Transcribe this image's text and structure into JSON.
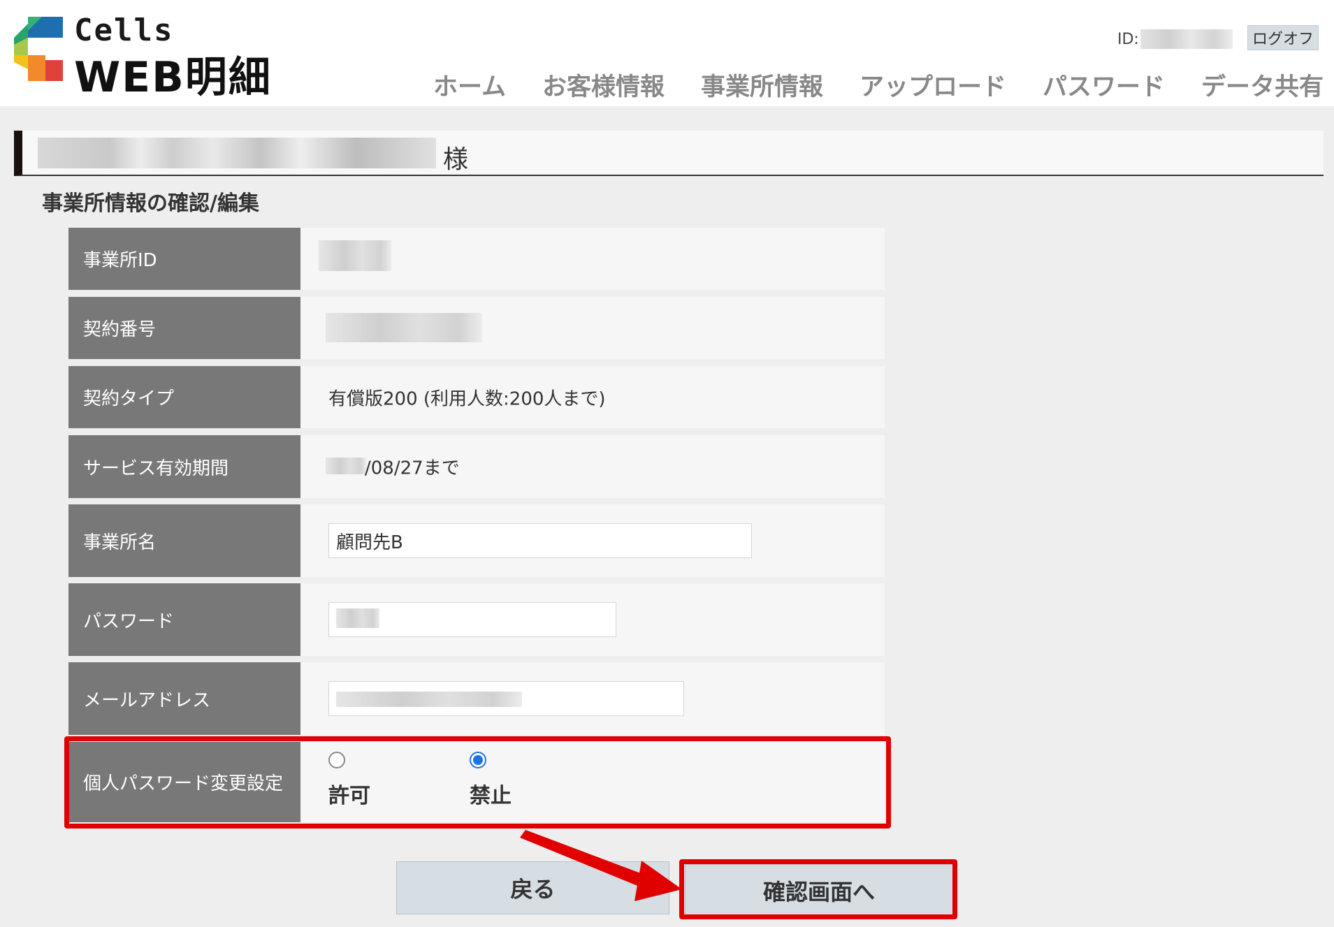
{
  "header": {
    "logo_small": "Cells",
    "logo_big": "WEB明細",
    "id_label": "ID:",
    "logoff_label": "ログオフ",
    "nav": [
      "ホーム",
      "お客様情報",
      "事業所情報",
      "アップロード",
      "パスワード",
      "データ共有"
    ]
  },
  "customer": {
    "suffix": "様"
  },
  "section_title": "事業所情報の確認/編集",
  "form": {
    "office_id_label": "事業所ID",
    "contract_no_label": "契約番号",
    "contract_type_label": "契約タイプ",
    "contract_type_value": "有償版200 (利用人数:200人まで)",
    "service_period_label": "サービス有効期間",
    "service_period_value": "/08/27まで",
    "office_name_label": "事業所名",
    "office_name_value": "顧問先B",
    "password_label": "パスワード",
    "email_label": "メールアドレス",
    "pw_change_label": "個人パスワード変更設定",
    "pw_change_options": [
      "許可",
      "禁止"
    ],
    "pw_change_selected": "禁止"
  },
  "buttons": {
    "back": "戻る",
    "confirm": "確認画面へ"
  },
  "colors": {
    "label_bg": "#787878",
    "highlight": "#e00000",
    "radio_checked": "#1a73e8",
    "button_bg": "#d6dde3"
  }
}
